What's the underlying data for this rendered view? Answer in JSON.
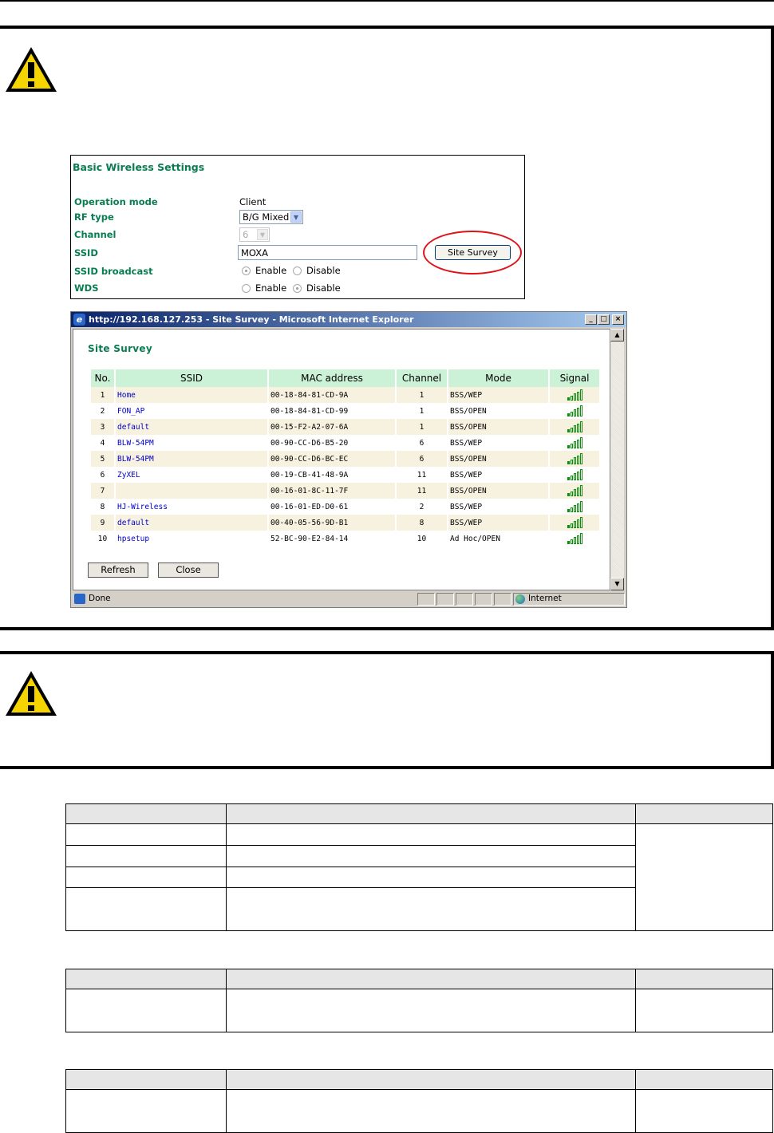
{
  "basic_settings": {
    "title": "Basic Wireless Settings",
    "labels": [
      "Operation mode",
      "RF type",
      "Channel",
      "SSID",
      "SSID broadcast",
      "WDS"
    ],
    "operation_mode_value": "Client",
    "rf_type_value": "B/G Mixed",
    "channel_value": "6",
    "ssid_value": "MOXA",
    "site_survey_button": "Site Survey",
    "enable_label": "Enable",
    "disable_label": "Disable"
  },
  "ie_window": {
    "title": "http://192.168.127.253 - Site Survey - Microsoft Internet Explorer",
    "page_title": "Site Survey",
    "columns": [
      "No.",
      "SSID",
      "MAC address",
      "Channel",
      "Mode",
      "Signal"
    ],
    "rows": [
      {
        "no": "1",
        "ssid": "Home",
        "mac": "00-18-84-81-CD-9A",
        "channel": "1",
        "mode": "BSS/WEP",
        "signal": 5
      },
      {
        "no": "2",
        "ssid": "FON_AP",
        "mac": "00-18-84-81-CD-99",
        "channel": "1",
        "mode": "BSS/OPEN",
        "signal": 5
      },
      {
        "no": "3",
        "ssid": "default",
        "mac": "00-15-F2-A2-07-6A",
        "channel": "1",
        "mode": "BSS/OPEN",
        "signal": 5
      },
      {
        "no": "4",
        "ssid": "BLW-54PM",
        "mac": "00-90-CC-D6-B5-20",
        "channel": "6",
        "mode": "BSS/WEP",
        "signal": 5
      },
      {
        "no": "5",
        "ssid": "BLW-54PM",
        "mac": "00-90-CC-D6-BC-EC",
        "channel": "6",
        "mode": "BSS/OPEN",
        "signal": 5
      },
      {
        "no": "6",
        "ssid": "ZyXEL",
        "mac": "00-19-CB-41-48-9A",
        "channel": "11",
        "mode": "BSS/WEP",
        "signal": 5
      },
      {
        "no": "7",
        "ssid": "",
        "mac": "00-16-01-8C-11-7F",
        "channel": "11",
        "mode": "BSS/OPEN",
        "signal": 5
      },
      {
        "no": "8",
        "ssid": "HJ-Wireless",
        "mac": "00-16-01-ED-D0-61",
        "channel": "2",
        "mode": "BSS/WEP",
        "signal": 5
      },
      {
        "no": "9",
        "ssid": "default",
        "mac": "00-40-05-56-9D-B1",
        "channel": "8",
        "mode": "BSS/WEP",
        "signal": 5
      },
      {
        "no": "10",
        "ssid": "hpsetup",
        "mac": "52-BC-90-E2-84-14",
        "channel": "10",
        "mode": "Ad Hoc/OPEN",
        "signal": 5
      }
    ],
    "refresh_button": "Refresh",
    "close_button": "Close",
    "status_text": "Done",
    "zone_text": "Internet"
  },
  "colors": {
    "label_green": "#097d51",
    "header_green": "#cbf1d6",
    "row_cream": "#f7f2df",
    "survey_circle": "#e0121a"
  },
  "icons": [
    "warning-icon",
    "ie-page-icon",
    "globe-icon",
    "signal-bars-icon"
  ]
}
